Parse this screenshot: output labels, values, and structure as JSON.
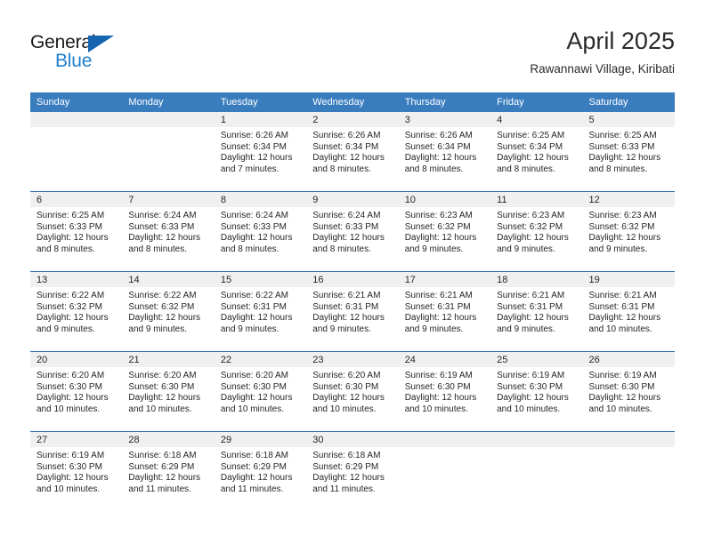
{
  "brand": {
    "name_part1": "General",
    "name_part2": "Blue",
    "accent_color": "#1f7fd0",
    "triangle_color": "#1565b0"
  },
  "header": {
    "title": "April 2025",
    "subtitle": "Rawannawi Village, Kiribati"
  },
  "theme": {
    "header_row_bg": "#3a7dbf",
    "row_divider": "#2a6fb0",
    "daynum_band_bg": "#f0f0f0",
    "text_color": "#262626"
  },
  "weekday_headers": [
    "Sunday",
    "Monday",
    "Tuesday",
    "Wednesday",
    "Thursday",
    "Friday",
    "Saturday"
  ],
  "weeks": [
    [
      {
        "day": "",
        "lines": []
      },
      {
        "day": "",
        "lines": []
      },
      {
        "day": "1",
        "lines": [
          "Sunrise: 6:26 AM",
          "Sunset: 6:34 PM",
          "Daylight: 12 hours",
          "and 7 minutes."
        ]
      },
      {
        "day": "2",
        "lines": [
          "Sunrise: 6:26 AM",
          "Sunset: 6:34 PM",
          "Daylight: 12 hours",
          "and 8 minutes."
        ]
      },
      {
        "day": "3",
        "lines": [
          "Sunrise: 6:26 AM",
          "Sunset: 6:34 PM",
          "Daylight: 12 hours",
          "and 8 minutes."
        ]
      },
      {
        "day": "4",
        "lines": [
          "Sunrise: 6:25 AM",
          "Sunset: 6:34 PM",
          "Daylight: 12 hours",
          "and 8 minutes."
        ]
      },
      {
        "day": "5",
        "lines": [
          "Sunrise: 6:25 AM",
          "Sunset: 6:33 PM",
          "Daylight: 12 hours",
          "and 8 minutes."
        ]
      }
    ],
    [
      {
        "day": "6",
        "lines": [
          "Sunrise: 6:25 AM",
          "Sunset: 6:33 PM",
          "Daylight: 12 hours",
          "and 8 minutes."
        ]
      },
      {
        "day": "7",
        "lines": [
          "Sunrise: 6:24 AM",
          "Sunset: 6:33 PM",
          "Daylight: 12 hours",
          "and 8 minutes."
        ]
      },
      {
        "day": "8",
        "lines": [
          "Sunrise: 6:24 AM",
          "Sunset: 6:33 PM",
          "Daylight: 12 hours",
          "and 8 minutes."
        ]
      },
      {
        "day": "9",
        "lines": [
          "Sunrise: 6:24 AM",
          "Sunset: 6:33 PM",
          "Daylight: 12 hours",
          "and 8 minutes."
        ]
      },
      {
        "day": "10",
        "lines": [
          "Sunrise: 6:23 AM",
          "Sunset: 6:32 PM",
          "Daylight: 12 hours",
          "and 9 minutes."
        ]
      },
      {
        "day": "11",
        "lines": [
          "Sunrise: 6:23 AM",
          "Sunset: 6:32 PM",
          "Daylight: 12 hours",
          "and 9 minutes."
        ]
      },
      {
        "day": "12",
        "lines": [
          "Sunrise: 6:23 AM",
          "Sunset: 6:32 PM",
          "Daylight: 12 hours",
          "and 9 minutes."
        ]
      }
    ],
    [
      {
        "day": "13",
        "lines": [
          "Sunrise: 6:22 AM",
          "Sunset: 6:32 PM",
          "Daylight: 12 hours",
          "and 9 minutes."
        ]
      },
      {
        "day": "14",
        "lines": [
          "Sunrise: 6:22 AM",
          "Sunset: 6:32 PM",
          "Daylight: 12 hours",
          "and 9 minutes."
        ]
      },
      {
        "day": "15",
        "lines": [
          "Sunrise: 6:22 AM",
          "Sunset: 6:31 PM",
          "Daylight: 12 hours",
          "and 9 minutes."
        ]
      },
      {
        "day": "16",
        "lines": [
          "Sunrise: 6:21 AM",
          "Sunset: 6:31 PM",
          "Daylight: 12 hours",
          "and 9 minutes."
        ]
      },
      {
        "day": "17",
        "lines": [
          "Sunrise: 6:21 AM",
          "Sunset: 6:31 PM",
          "Daylight: 12 hours",
          "and 9 minutes."
        ]
      },
      {
        "day": "18",
        "lines": [
          "Sunrise: 6:21 AM",
          "Sunset: 6:31 PM",
          "Daylight: 12 hours",
          "and 9 minutes."
        ]
      },
      {
        "day": "19",
        "lines": [
          "Sunrise: 6:21 AM",
          "Sunset: 6:31 PM",
          "Daylight: 12 hours",
          "and 10 minutes."
        ]
      }
    ],
    [
      {
        "day": "20",
        "lines": [
          "Sunrise: 6:20 AM",
          "Sunset: 6:30 PM",
          "Daylight: 12 hours",
          "and 10 minutes."
        ]
      },
      {
        "day": "21",
        "lines": [
          "Sunrise: 6:20 AM",
          "Sunset: 6:30 PM",
          "Daylight: 12 hours",
          "and 10 minutes."
        ]
      },
      {
        "day": "22",
        "lines": [
          "Sunrise: 6:20 AM",
          "Sunset: 6:30 PM",
          "Daylight: 12 hours",
          "and 10 minutes."
        ]
      },
      {
        "day": "23",
        "lines": [
          "Sunrise: 6:20 AM",
          "Sunset: 6:30 PM",
          "Daylight: 12 hours",
          "and 10 minutes."
        ]
      },
      {
        "day": "24",
        "lines": [
          "Sunrise: 6:19 AM",
          "Sunset: 6:30 PM",
          "Daylight: 12 hours",
          "and 10 minutes."
        ]
      },
      {
        "day": "25",
        "lines": [
          "Sunrise: 6:19 AM",
          "Sunset: 6:30 PM",
          "Daylight: 12 hours",
          "and 10 minutes."
        ]
      },
      {
        "day": "26",
        "lines": [
          "Sunrise: 6:19 AM",
          "Sunset: 6:30 PM",
          "Daylight: 12 hours",
          "and 10 minutes."
        ]
      }
    ],
    [
      {
        "day": "27",
        "lines": [
          "Sunrise: 6:19 AM",
          "Sunset: 6:30 PM",
          "Daylight: 12 hours",
          "and 10 minutes."
        ]
      },
      {
        "day": "28",
        "lines": [
          "Sunrise: 6:18 AM",
          "Sunset: 6:29 PM",
          "Daylight: 12 hours",
          "and 11 minutes."
        ]
      },
      {
        "day": "29",
        "lines": [
          "Sunrise: 6:18 AM",
          "Sunset: 6:29 PM",
          "Daylight: 12 hours",
          "and 11 minutes."
        ]
      },
      {
        "day": "30",
        "lines": [
          "Sunrise: 6:18 AM",
          "Sunset: 6:29 PM",
          "Daylight: 12 hours",
          "and 11 minutes."
        ]
      },
      {
        "day": "",
        "lines": []
      },
      {
        "day": "",
        "lines": []
      },
      {
        "day": "",
        "lines": []
      }
    ]
  ]
}
